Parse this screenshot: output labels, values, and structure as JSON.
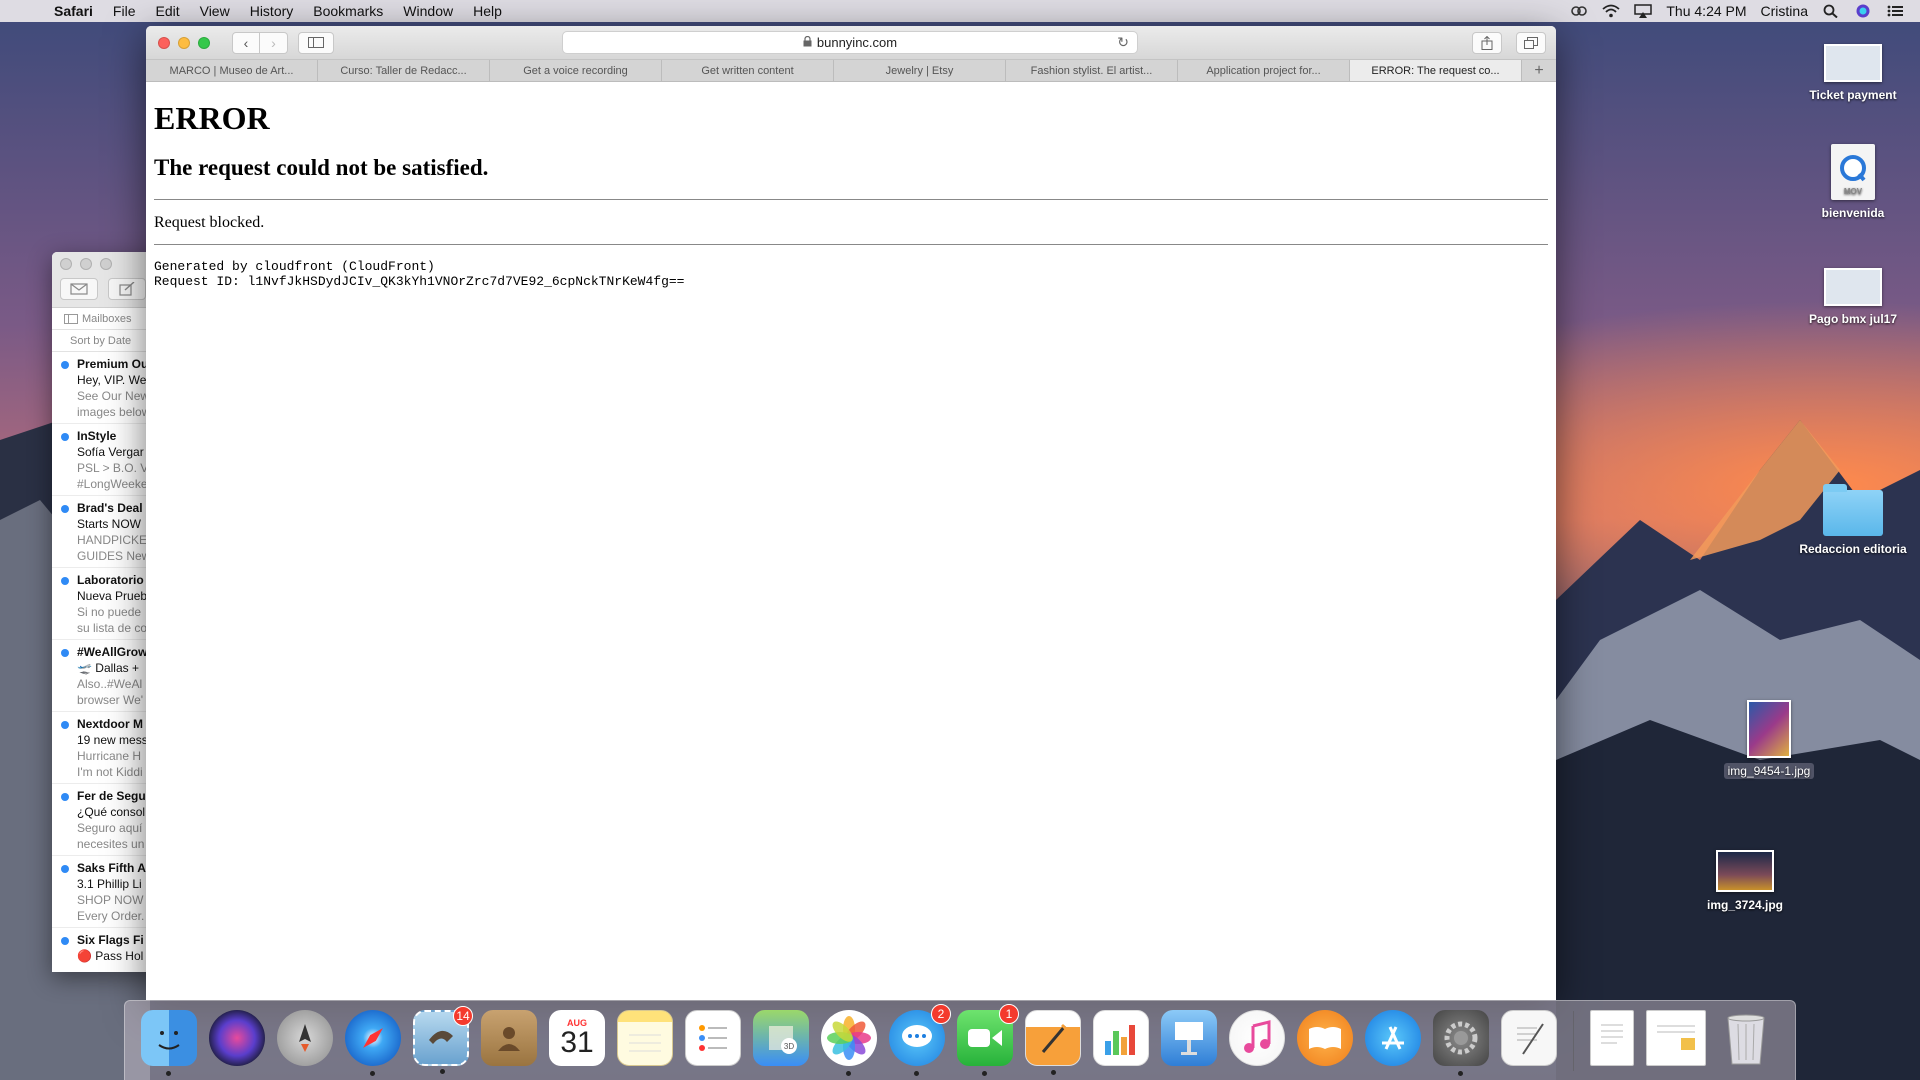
{
  "menubar": {
    "app": "Safari",
    "items": [
      "File",
      "Edit",
      "View",
      "History",
      "Bookmarks",
      "Window",
      "Help"
    ],
    "clock": "Thu 4:24 PM",
    "user": "Cristina"
  },
  "browser": {
    "url": "bunnyinc.com",
    "tabs": [
      {
        "label": "MARCO | Museo de Art..."
      },
      {
        "label": "Curso: Taller de Redacc..."
      },
      {
        "label": "Get a voice recording"
      },
      {
        "label": "Get written content"
      },
      {
        "label": "Jewelry | Etsy"
      },
      {
        "label": "Fashion stylist. El artist..."
      },
      {
        "label": "Application project for..."
      },
      {
        "label": "ERROR: The request co..."
      }
    ]
  },
  "page": {
    "heading": "ERROR",
    "subheading": "The request could not be satisfied.",
    "message": "Request blocked.",
    "generated": "Generated by cloudfront (CloudFront)",
    "request_id": "Request ID: l1NvfJkHSDydJCIv_QK3kYh1VNOrZrc7d7VE92_6cpNckTNrKeW4fg=="
  },
  "mail": {
    "mailboxes_label": "Mailboxes",
    "sort_label": "Sort by Date",
    "messages": [
      {
        "from": "Premium Ou",
        "subject": "Hey, VIP. We",
        "preview1": "See Our New",
        "preview2": "images below"
      },
      {
        "from": "InStyle",
        "subject": "Sofía Vergar",
        "preview1": "PSL > B.O. V",
        "preview2": "#LongWeeke"
      },
      {
        "from": "Brad's Deal",
        "subject": "Starts NOW",
        "preview1": "HANDPICKE",
        "preview2": "GUIDES New"
      },
      {
        "from": "Laboratorio",
        "subject": "Nueva Prueb",
        "preview1": "Si no puede",
        "preview2": "su lista de co"
      },
      {
        "from": "#WeAllGrow",
        "subject": "🛫 Dallas +",
        "preview1": "Also..#WeAl",
        "preview2": "browser We'"
      },
      {
        "from": "Nextdoor M",
        "subject": "19 new mess",
        "preview1": "Hurricane H",
        "preview2": "I'm not Kiddi"
      },
      {
        "from": "Fer de Segu",
        "subject": "¿Qué consol",
        "preview1": "Seguro aquí",
        "preview2": "necesites un"
      },
      {
        "from": "Saks Fifth A",
        "subject": "3.1 Phillip Li",
        "preview1": "SHOP NOW",
        "preview2": "Every Order."
      },
      {
        "from": "Six Flags Fi",
        "subject": "🔴 Pass Hol",
        "preview1": "",
        "preview2": ""
      }
    ]
  },
  "desktop": {
    "icons": [
      {
        "label": "Ticket payment"
      },
      {
        "label": "bienvenida"
      },
      {
        "label": "Pago bmx jul17"
      },
      {
        "label": "Redaccion editoria"
      },
      {
        "label": "img_9454-1.jpg"
      },
      {
        "label": "img_3724.jpg"
      }
    ]
  },
  "dock": {
    "calendar_month": "AUG",
    "calendar_day": "31",
    "mail_badge": "14",
    "messages_badge": "2",
    "facetime_badge": "1"
  }
}
